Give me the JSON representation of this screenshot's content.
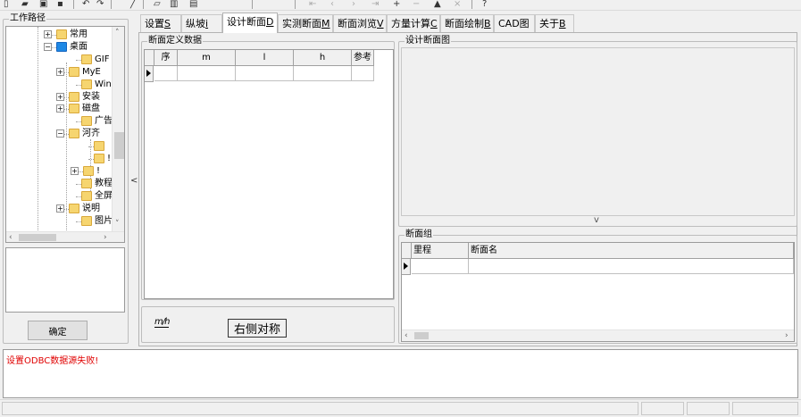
{
  "colors": {
    "error_text": "#e00000",
    "window_bg": "#f0f0f0"
  },
  "toolbar": {
    "icons": [
      "new-document-icon",
      "open-folder-icon",
      "settings-icon",
      "save-icon",
      "undo-icon",
      "redo-icon",
      "cursor-icon",
      "chart-icon",
      "table-icon",
      "first-icon",
      "prev-icon",
      "next-icon",
      "last-icon",
      "add-icon",
      "remove-icon",
      "up-icon",
      "delete-icon",
      "help-icon"
    ]
  },
  "left": {
    "work_path_title": "工作路径",
    "tree": [
      {
        "label": "常用",
        "expander": "+"
      },
      {
        "label": "桌面",
        "expander": "−"
      },
      {
        "label": "GIF",
        "expander": ""
      },
      {
        "label": "MyE",
        "expander": "+"
      },
      {
        "label": "Win",
        "expander": ""
      },
      {
        "label": "安装",
        "expander": "+"
      },
      {
        "label": "磁盘",
        "expander": "+"
      },
      {
        "label": "广告",
        "expander": ""
      },
      {
        "label": "河齐",
        "expander": "−"
      },
      {
        "label": "",
        "expander": ""
      },
      {
        "label": "!",
        "expander": ""
      },
      {
        "label": "!",
        "expander": "+"
      },
      {
        "label": "教程",
        "expander": ""
      },
      {
        "label": "全屏",
        "expander": ""
      },
      {
        "label": "说明",
        "expander": "+"
      },
      {
        "label": "图片",
        "expander": ""
      }
    ],
    "confirm_label": "确定",
    "collapse_glyph": "<<"
  },
  "tabs": [
    {
      "label": "设置",
      "hotkey": "S"
    },
    {
      "label": "纵坡",
      "hotkey": "i"
    },
    {
      "label": "设计断面",
      "hotkey": "D"
    },
    {
      "label": "实测断面",
      "hotkey": "M"
    },
    {
      "label": "断面浏览",
      "hotkey": "V"
    },
    {
      "label": "方量计算",
      "hotkey": "C"
    },
    {
      "label": "断面绘制",
      "hotkey": "B"
    },
    {
      "label": "CAD图",
      "hotkey": ""
    },
    {
      "label": "关于",
      "hotkey": "B"
    }
  ],
  "section_def": {
    "title": "断面定义数据",
    "columns": [
      "序",
      "m",
      "l",
      "h",
      "参考"
    ]
  },
  "mirror": {
    "label": "右侧对称",
    "icon_glyph": "m/h"
  },
  "design_view": {
    "title": "设计断面图",
    "splitter_glyph": "v"
  },
  "section_group": {
    "title": "断面组",
    "columns": [
      "里程",
      "断面名"
    ]
  },
  "status": {
    "message": "设置ODBC数据源失败!"
  }
}
